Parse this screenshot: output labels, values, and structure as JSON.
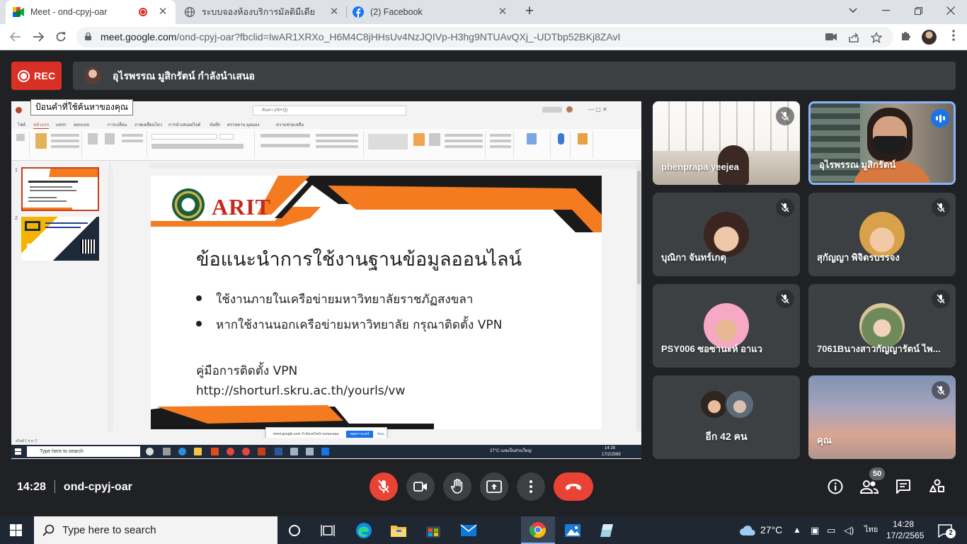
{
  "browser": {
    "tabs": [
      {
        "title": "Meet - ond-cpyj-oar",
        "active": true,
        "recording": true
      },
      {
        "title": "ระบบจองห้องบริการมัลติมีเดีย",
        "active": false
      },
      {
        "title": "(2) Facebook",
        "active": false
      }
    ],
    "url_main": "meet.google.com",
    "url_rest": "/ond-cpyj-oar?fbclid=IwAR1XRXo_H6M4C8jHHsUv4NzJQIVp-H3hg9NTUAvQXj_-UDTbp52BKj8ZAvI"
  },
  "meet": {
    "rec_label": "REC",
    "presenter_text": "อุไรพรรณ มูสิกรัตน์ กำลังนำเสนอ",
    "meeting_time": "14:28",
    "meeting_code": "ond-cpyj-oar",
    "participant_count": "50",
    "accent": "#8ab4f8",
    "hangup_color": "#ea4335"
  },
  "share": {
    "tooltip": "ป้อนคำที่ใช้ค้นหาของคุณ",
    "search_box": "ค้นหา (Alt+Q)",
    "ribbon_tabs": [
      "ไฟล์",
      "หน้าแรก",
      "แทรก",
      "ออกแบบ",
      "การเปลี่ยน",
      "ภาพเคลื่อนไหว",
      "การนำเสนอสไลด์",
      "บันทึก",
      "ตรวจทาน",
      "มุมมอง",
      "ความช่วยเหลือ"
    ],
    "slide_numbers": [
      "1",
      "2"
    ],
    "slide": {
      "logo_text": "ARIT",
      "title": "ข้อแนะนำการใช้งานฐานข้อมูลออนไลน์",
      "bullets": [
        "ใช้งานภายในเครือข่ายมหาวิทยาลัยราชภัฏสงขลา",
        "หากใช้งานนอกเครือข่ายมหาวิทยาลัย กรุณาติดตั้ง VPN"
      ],
      "manual_label": "คู่มือการติดตั้ง VPN",
      "manual_url": "http://shorturl.skru.ac.th/yourls/vw"
    },
    "notification": "meet.google.com กำลังแชร์หน้าจอของคุณ",
    "notification_button": "หยุดการแชร์",
    "notification_hide": "ซ่อน",
    "status_left": "สไลด์ 1 จาก 2",
    "inner_search": "Type here to search",
    "inner_weather": "27°C เมฆเป็นส่วนใหญ่",
    "inner_time": "14:28",
    "inner_date": "17/2/2565"
  },
  "participants": [
    {
      "name": "phenprapa yeejea",
      "muted": true,
      "type": "video"
    },
    {
      "name": "อุไรพรรณ มูสิกรัตน์",
      "muted": false,
      "type": "video",
      "speaking": true
    },
    {
      "name": "บุณิกา จันทร์เกตุ",
      "muted": true,
      "type": "avatar"
    },
    {
      "name": "สุกัญญา พิจิตรบรรจง",
      "muted": true,
      "type": "avatar"
    },
    {
      "name": "PSY006 ซอซานะห์ อาแว",
      "muted": true,
      "type": "avatar"
    },
    {
      "name": "7061Bนางสาวกัญญารัตน์ ไพ...",
      "muted": true,
      "type": "avatar"
    },
    {
      "name": "อีก 42 คน",
      "muted": false,
      "type": "others"
    },
    {
      "name": "คุณ",
      "muted": true,
      "type": "self"
    }
  ],
  "taskbar": {
    "search_placeholder": "Type here to search",
    "weather": "27°C",
    "lang": "ไทย",
    "time": "14:28",
    "date": "17/2/2565",
    "notif_count": "2"
  }
}
